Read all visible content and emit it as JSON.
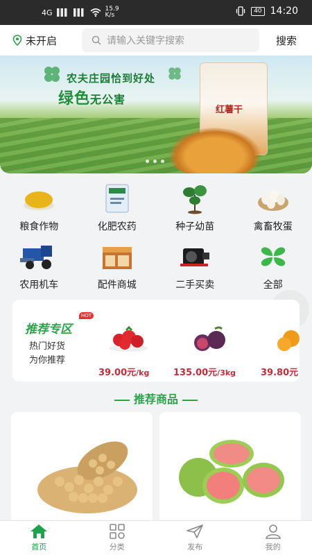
{
  "status_bar": {
    "net": "4G",
    "speed_top": "15.9",
    "speed_bottom": "K/s",
    "battery": "40",
    "time": "14:20"
  },
  "header": {
    "location": "未开启",
    "search_placeholder": "请输入关键字搜索",
    "search_button": "搜索"
  },
  "banner": {
    "line1": "农夫庄园恰到好处",
    "line2_big": "绿色",
    "line2_small": "无公害",
    "product_label": "红薯干"
  },
  "categories": [
    {
      "label": "粮食作物",
      "icon": "grain-icon"
    },
    {
      "label": "化肥农药",
      "icon": "fertilizer-icon"
    },
    {
      "label": "种子幼苗",
      "icon": "seedling-icon"
    },
    {
      "label": "禽畜牧蛋",
      "icon": "eggs-icon"
    },
    {
      "label": "农用机车",
      "icon": "tractor-icon"
    },
    {
      "label": "配件商城",
      "icon": "parts-store-icon"
    },
    {
      "label": "二手买卖",
      "icon": "engine-icon"
    },
    {
      "label": "全部",
      "icon": "clover-icon"
    }
  ],
  "recommend": {
    "title": "推荐专区",
    "badge": "HOT",
    "sub1": "热门好货",
    "sub2": "为你推荐",
    "items": [
      {
        "name": "strawberry",
        "price": "39.00元",
        "unit": "/kg"
      },
      {
        "name": "fig",
        "price": "135.00元",
        "unit": "/3kg"
      },
      {
        "name": "orange",
        "price": "39.80元",
        "unit": ""
      }
    ]
  },
  "section_title": "推荐商品",
  "tabs": [
    {
      "label": "首页",
      "icon": "home-icon",
      "active": true
    },
    {
      "label": "分类",
      "icon": "category-icon",
      "active": false
    },
    {
      "label": "发布",
      "icon": "send-icon",
      "active": false
    },
    {
      "label": "我的",
      "icon": "user-icon",
      "active": false
    }
  ],
  "colors": {
    "accent": "#1fa34a",
    "price": "#c22d3a"
  }
}
